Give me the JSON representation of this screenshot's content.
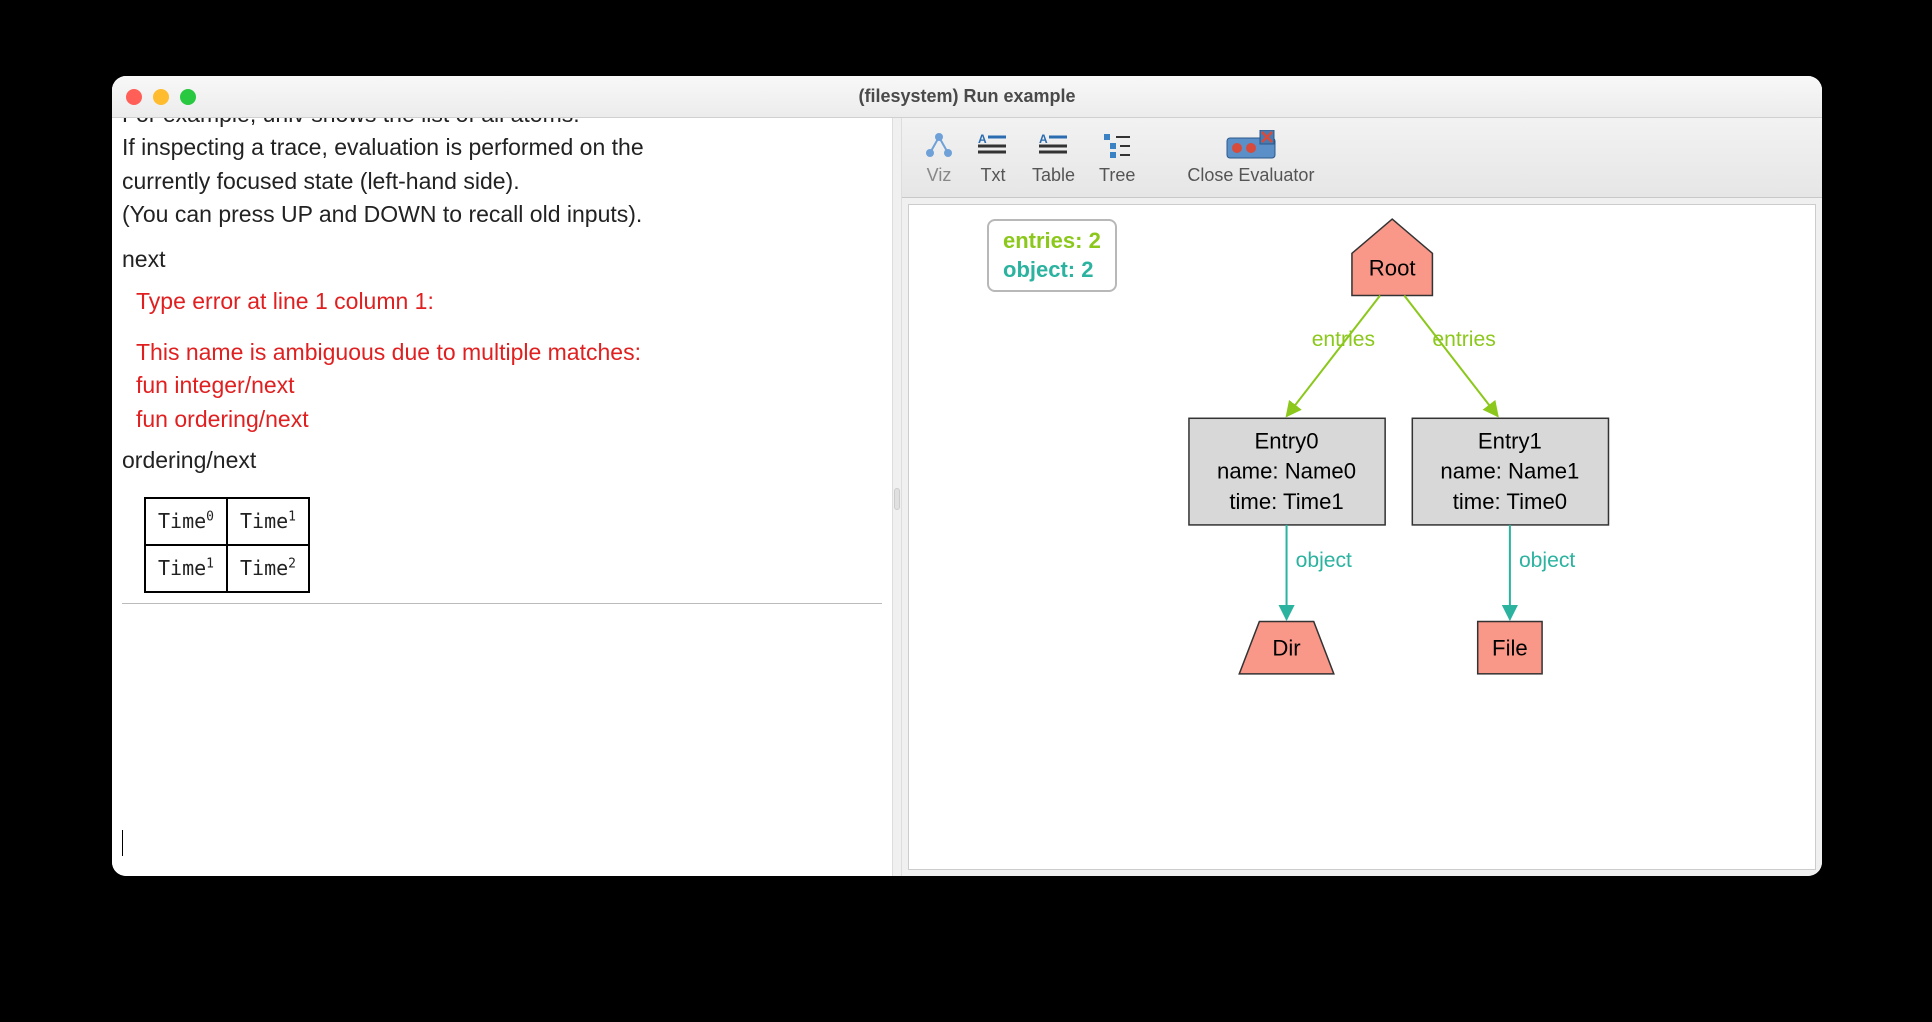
{
  "window": {
    "title": "(filesystem) Run example"
  },
  "console": {
    "cut_line": "For example, univ shows the list of all atoms.",
    "line1": "If inspecting a trace, evaluation is performed on the",
    "line2": "currently focused state (left-hand side).",
    "line3": "(You can press UP and DOWN to recall old inputs).",
    "cmd1": "next",
    "err_title": "Type error at line 1 column 1:",
    "err_msg": "This name is ambiguous due to multiple matches:",
    "err_opt1": "fun integer/next",
    "err_opt2": "fun ordering/next",
    "cmd2": "ordering/next",
    "table": {
      "r0c0": "Time",
      "r0c0_sup": "0",
      "r0c1": "Time",
      "r0c1_sup": "1",
      "r1c0": "Time",
      "r1c0_sup": "1",
      "r1c1": "Time",
      "r1c1_sup": "2"
    },
    "input_value": ""
  },
  "toolbar": {
    "viz": "Viz",
    "txt": "Txt",
    "table": "Table",
    "tree": "Tree",
    "close": "Close Evaluator"
  },
  "legend": {
    "entries": "entries: 2",
    "object": "object: 2"
  },
  "graph": {
    "root": "Root",
    "entry0_l1": "Entry0",
    "entry0_l2": "name: Name0",
    "entry0_l3": "time: Time1",
    "entry1_l1": "Entry1",
    "entry1_l2": "name: Name1",
    "entry1_l3": "time: Time0",
    "dir": "Dir",
    "file": "File",
    "edge_entries": "entries",
    "edge_object": "object"
  }
}
